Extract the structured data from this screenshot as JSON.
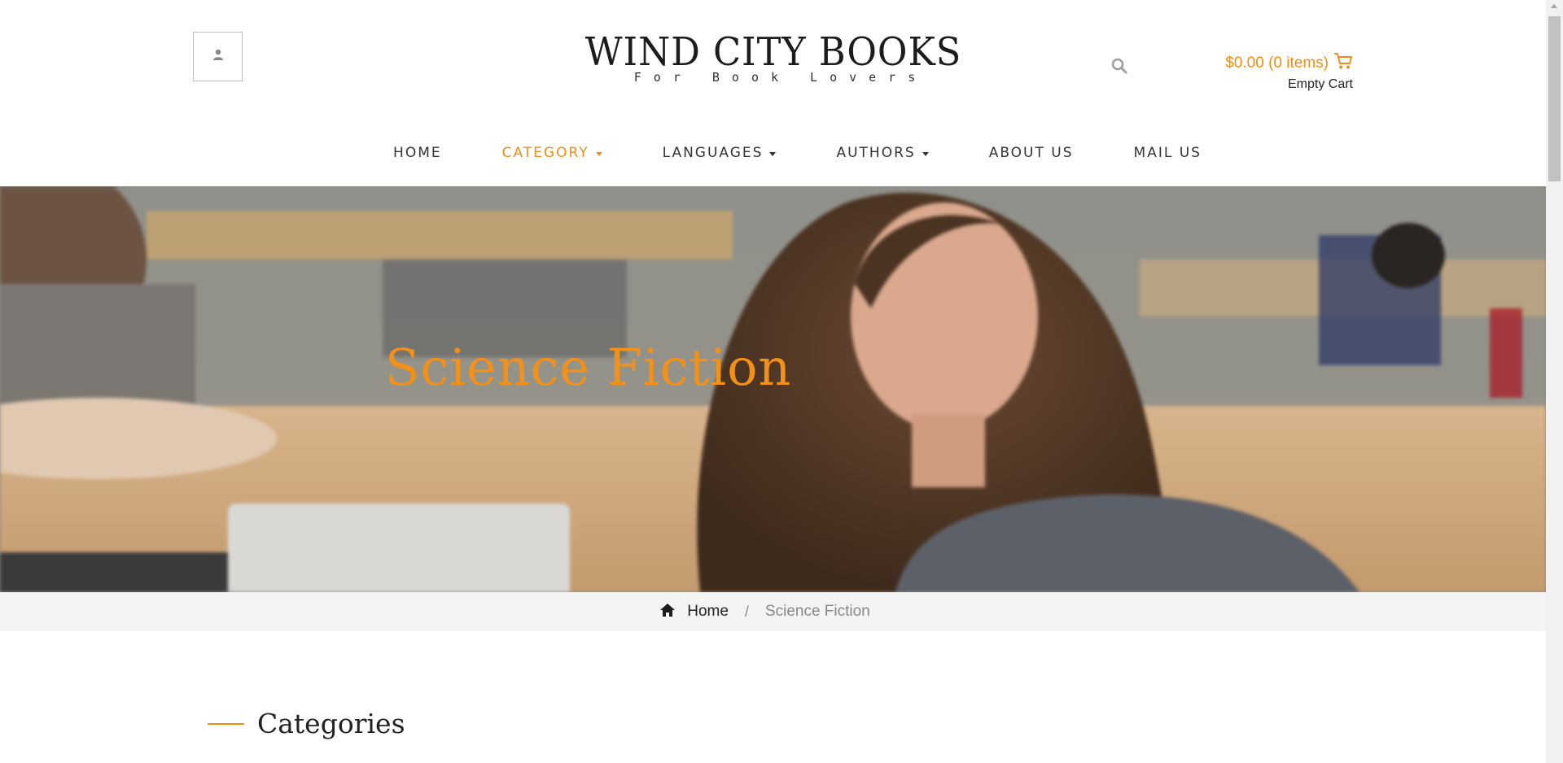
{
  "brand": {
    "title": "WIND CITY BOOKS",
    "tagline": "For Book Lovers"
  },
  "header": {
    "account_icon": "user-icon",
    "search_icon": "search-icon",
    "cart": {
      "total": "$0.00 (0 items)",
      "status": "Empty Cart",
      "icon": "shopping-cart-icon"
    }
  },
  "nav": {
    "home": "HOME",
    "category": "CATEGORY",
    "languages": "LANGUAGES",
    "authors": "AUTHORS",
    "about": "ABOUT US",
    "mail": "MAIL US"
  },
  "hero": {
    "title": "Science Fiction"
  },
  "breadcrumb": {
    "home_icon": "home-icon",
    "home": "Home",
    "separator": "/",
    "current": "Science Fiction"
  },
  "sidebar": {
    "heading": "Categories"
  },
  "colors": {
    "accent": "#f28c13",
    "text": "#222222",
    "muted": "#888888",
    "breadcrumb_bg": "#f4f4f4"
  }
}
